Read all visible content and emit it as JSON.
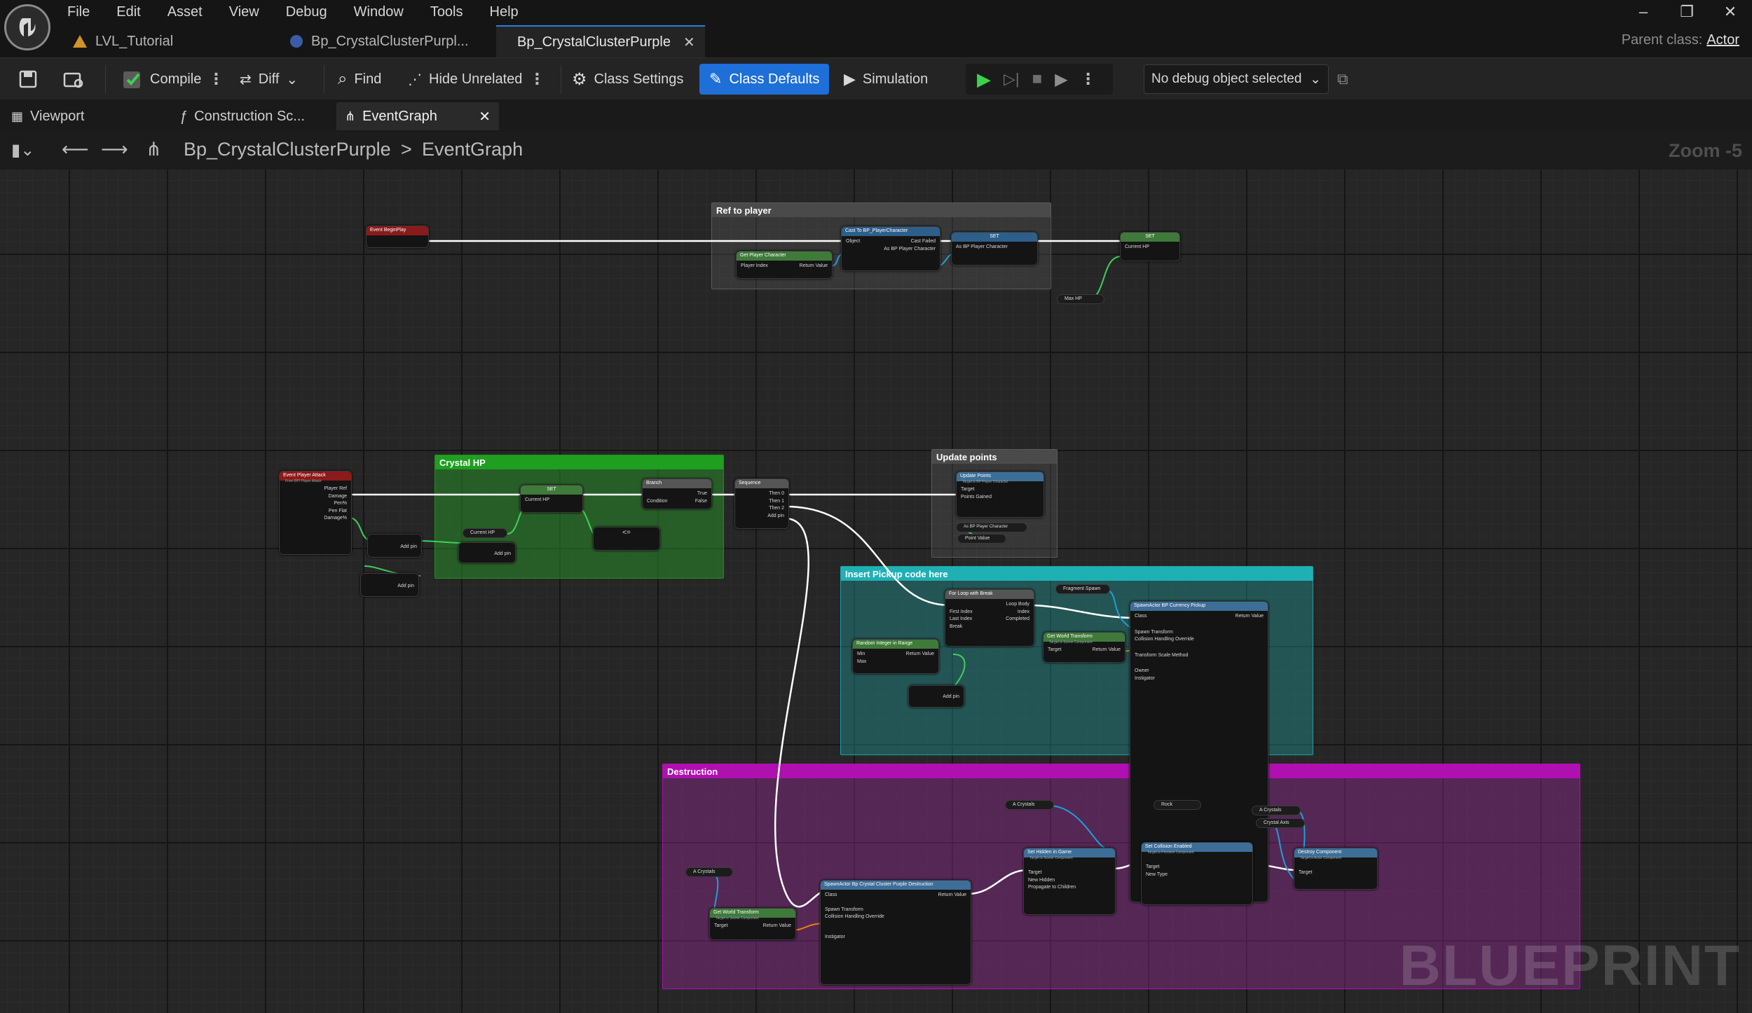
{
  "menu": [
    "File",
    "Edit",
    "Asset",
    "View",
    "Debug",
    "Window",
    "Tools",
    "Help"
  ],
  "doc_tabs": [
    {
      "label": "LVL_Tutorial"
    },
    {
      "label": "Bp_CrystalClusterPurpl..."
    },
    {
      "label": "Bp_CrystalClusterPurple"
    }
  ],
  "parent_class": {
    "label": "Parent class:",
    "value": "Actor"
  },
  "toolbar": {
    "compile": "Compile",
    "diff": "Diff",
    "find": "Find",
    "hide_unrelated": "Hide Unrelated",
    "class_settings": "Class Settings",
    "class_defaults": "Class Defaults",
    "simulation": "Simulation",
    "debug_object": "No debug object selected"
  },
  "panel_tabs": [
    "Viewport",
    "Construction Sc...",
    "EventGraph"
  ],
  "breadcrumb": {
    "root": "Bp_CrystalClusterPurple",
    "separator": ">",
    "current": "EventGraph"
  },
  "zoom": "Zoom -5",
  "watermark": "BLUEPRINT",
  "comments": {
    "ref_to_player": "Ref to player",
    "crystal_hp": "Crystal HP",
    "update_points": "Update points",
    "insert_pickup": "Insert Pickup code here",
    "destruction": "Destruction"
  },
  "nodes": {
    "begin_play": "Event BeginPlay",
    "cast": "Cast To BP_PlayerCharacter",
    "cast_pins": [
      "Object",
      "Cast Failed",
      "As BP Player Character"
    ],
    "get_player": "Get Player Character",
    "get_player_pins": [
      "Player Index",
      "Return Value"
    ],
    "set1": "SET",
    "set1_pin": "As BP Player Character",
    "set2": "SET",
    "set2_pin": "Current HP",
    "max_hp": "Max HP",
    "player_attack": "Event Player Attack",
    "player_attack_sub": "From BPI Player Attack",
    "player_attack_pins": [
      "Player Ref",
      "Damage",
      "Pen%",
      "Pen Flat",
      "Damage%"
    ],
    "set3": "SET",
    "set3_pin": "Current HP",
    "current_hp": "Current HP",
    "add_pin": "Add pin",
    "branch": "Branch",
    "branch_pins": [
      "Condition",
      "True",
      "False"
    ],
    "sequence": "Sequence",
    "sequence_pins": [
      "Then 0",
      "Then 1",
      "Then 2",
      "Add pin"
    ],
    "update_points": "Update Points",
    "update_points_sub": "Target is BP Player Character",
    "update_points_pins": [
      "Target",
      "Points Gained"
    ],
    "as_bp_player": "As BP Player Character",
    "point_value": "Point Value",
    "for_loop": "For Loop with Break",
    "for_loop_pins": [
      "First Index",
      "Last Index",
      "Break",
      "Loop Body",
      "Index",
      "Completed"
    ],
    "fragment_spawn": "Fragment Spawn",
    "random_int": "Random Integer in Range",
    "random_int_pins": [
      "Min",
      "Max",
      "Return Value"
    ],
    "world_transform": "Get World Transform",
    "world_transform_sub": "Target is Scene Component",
    "world_transform_pins": [
      "Target",
      "Return Value"
    ],
    "spawn_currency": "SpawnActor BP Currency Pickup",
    "spawn_currency_pins": [
      "Class",
      "Spawn Transform",
      "Collision Handling Override",
      "Transform Scale Method",
      "Owner",
      "Instigator",
      "Return Value"
    ],
    "a_crystals": "A Crystals",
    "rock": "Rock",
    "crystal_axis": "Crystal Axis",
    "spawn_destruction": "SpawnActor Bp Crystal Cluster Purple Destruction",
    "spawn_destruction_pins": [
      "Class",
      "Spawn Transform",
      "Collision Handling Override",
      "Instigator",
      "Return Value"
    ],
    "set_hidden": "Set Hidden in Game",
    "set_hidden_sub": "Target is Scene Component",
    "set_hidden_pins": [
      "Target",
      "New Hidden",
      "Propagate to Children"
    ],
    "set_collision": "Set Collision Enabled",
    "set_collision_sub": "Target is Primitive Component",
    "set_collision_pins": [
      "Target",
      "New Type"
    ],
    "destroy_component": "Destroy Component",
    "destroy_component_sub": "Target is Actor Component",
    "destroy_component_pins": [
      "Target"
    ]
  },
  "colors": {
    "accent": "#1e6fd8",
    "event_header": "#8b1a1a",
    "function_header": "#3d6e97",
    "pure_header": "#3f7a3a",
    "crystal_hp_comment": "#1f8f1f",
    "pickup_comment": "#1f9fa3",
    "destruction_comment": "#b010b0",
    "exec_wire": "#ffffff",
    "float_wire": "#3fd05a",
    "object_wire": "#1f9ed8",
    "transform_wire": "#f07b12"
  }
}
